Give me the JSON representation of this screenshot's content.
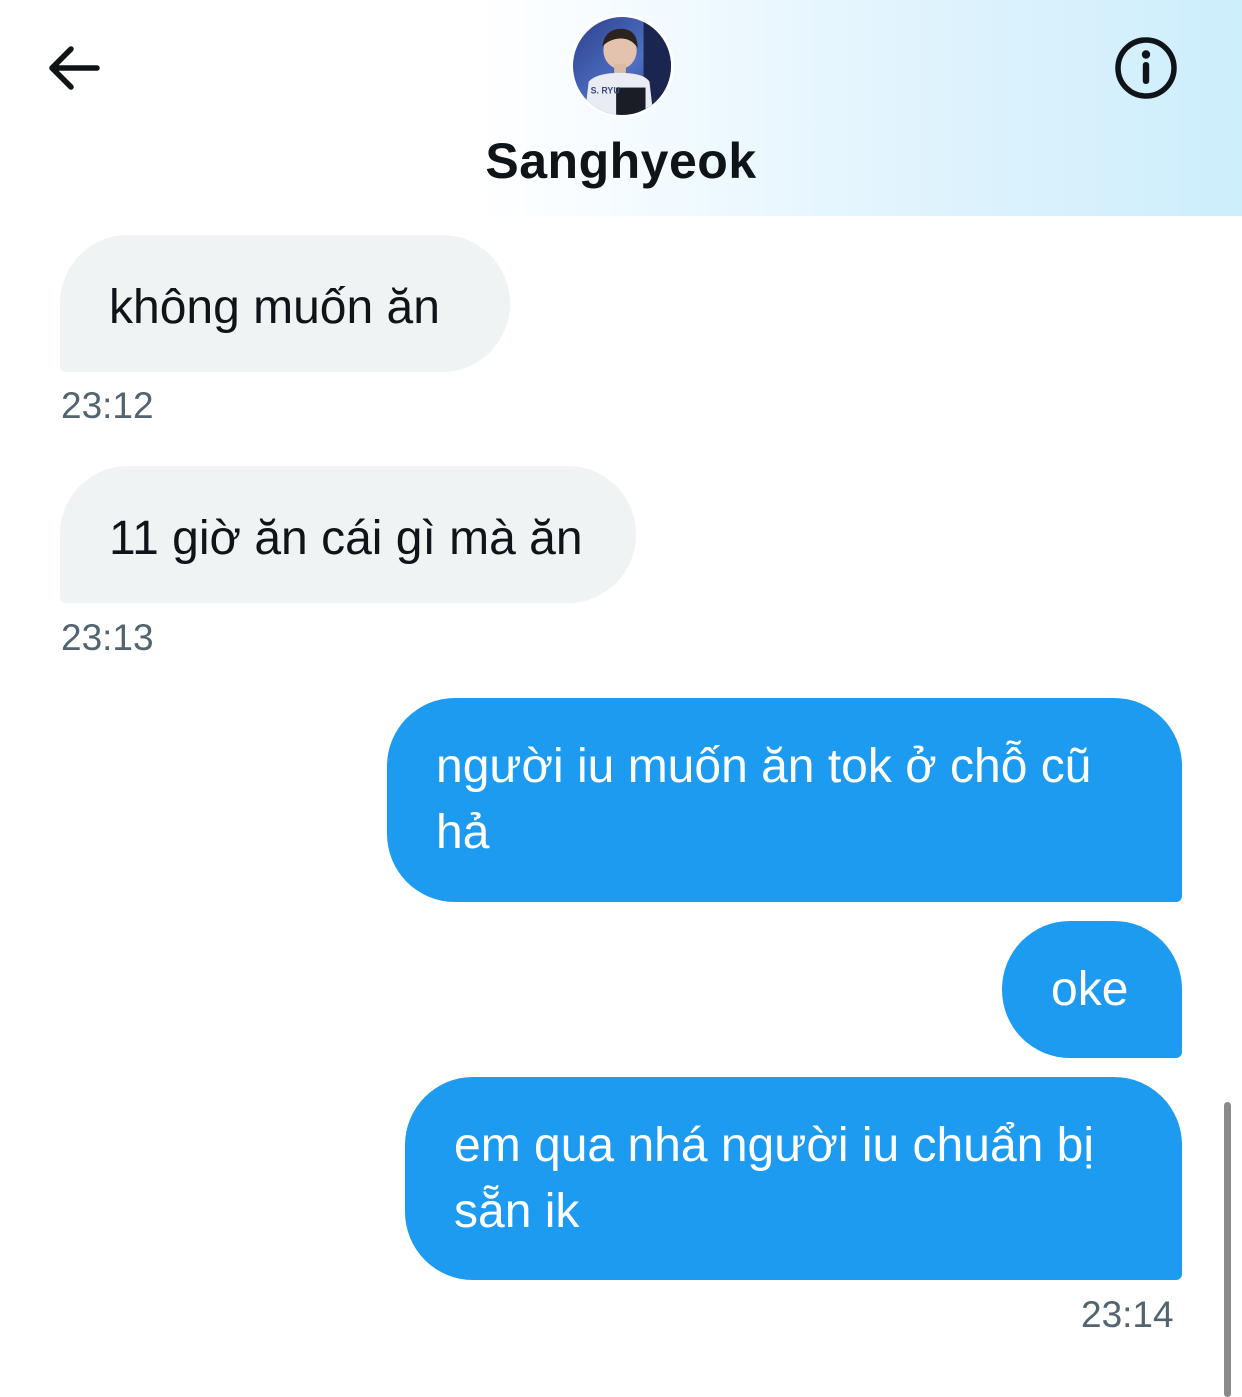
{
  "header": {
    "contact_name": "Sanghyeok",
    "back_icon": "arrow-left-icon",
    "info_icon": "info-circle-icon",
    "avatar_jersey_text": "S. RYU"
  },
  "messages": [
    {
      "direction": "incoming",
      "text": "không muốn ăn",
      "time": "23:12"
    },
    {
      "direction": "incoming",
      "text": "11 giờ ăn cái gì mà ăn",
      "time": "23:13"
    },
    {
      "direction": "outgoing",
      "text": "người iu muốn ăn tok ở chỗ cũ hả"
    },
    {
      "direction": "outgoing",
      "text": "oke"
    },
    {
      "direction": "outgoing",
      "text": "em qua nhá người iu chuẩn bị sẵn ik",
      "time": "23:14"
    }
  ],
  "colors": {
    "outgoing_bubble": "#1d9bf0",
    "incoming_bubble": "#eff3f4",
    "timestamp": "#536471",
    "text_primary": "#0f1419"
  }
}
